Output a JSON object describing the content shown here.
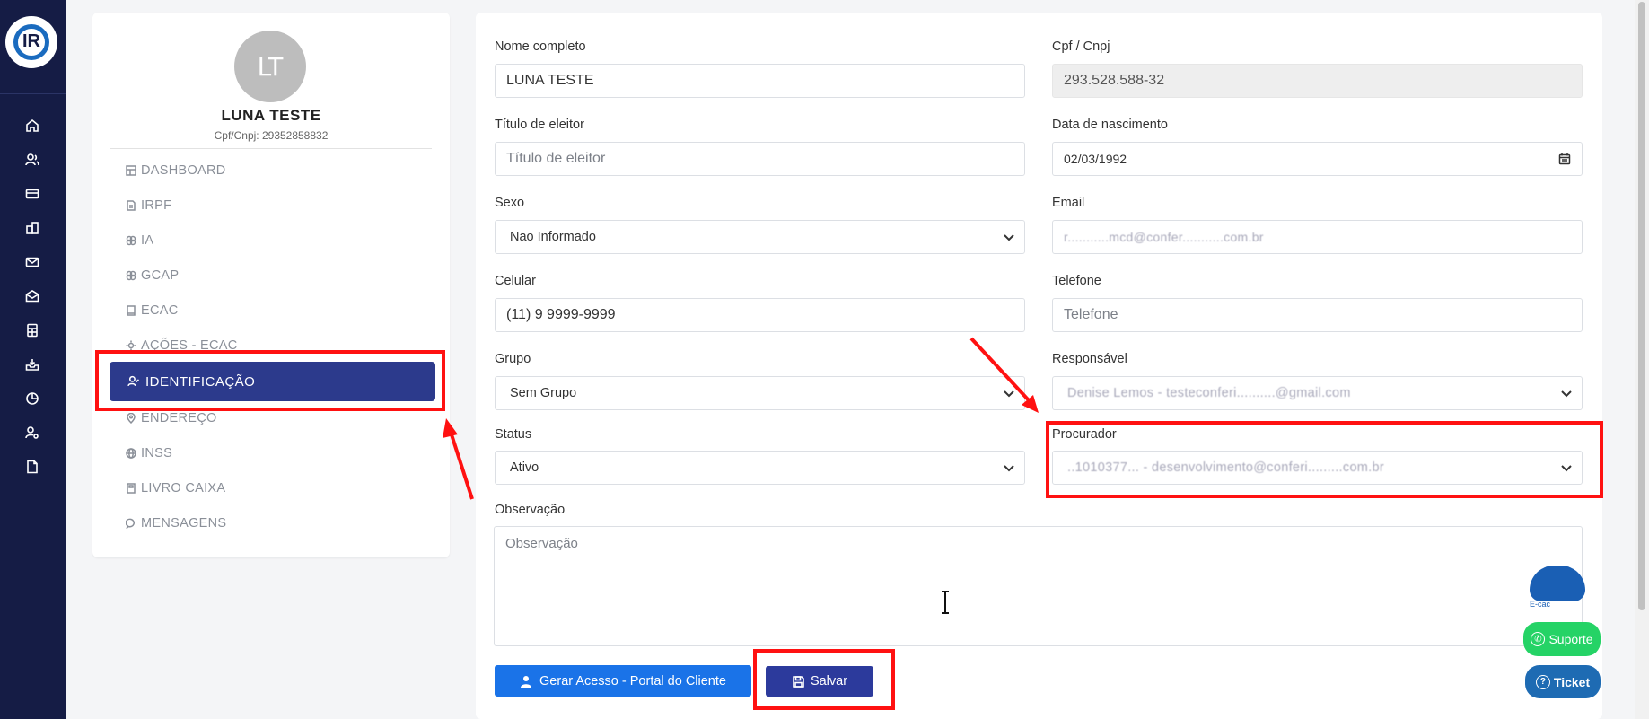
{
  "profile": {
    "initials": "LT",
    "name": "LUNA TESTE",
    "doc": "Cpf/Cnpj: 29352858832"
  },
  "menu": {
    "items": [
      {
        "label": "DASHBOARD"
      },
      {
        "label": "IRPF"
      },
      {
        "label": "IA"
      },
      {
        "label": "GCAP"
      },
      {
        "label": "ECAC"
      },
      {
        "label": "AÇÕES - ECAC"
      },
      {
        "label": "IDENTIFICAÇÃO"
      },
      {
        "label": "ENDEREÇO"
      },
      {
        "label": "INSS"
      },
      {
        "label": "LIVRO CAIXA"
      },
      {
        "label": "MENSAGENS"
      }
    ],
    "active": "IDENTIFICAÇÃO"
  },
  "rail": {
    "logo": "IR",
    "icons": [
      "home-icon",
      "users-icon",
      "card-icon",
      "building-icon",
      "mail-icon",
      "mail-open-icon",
      "spreadsheet-icon",
      "inbox-icon",
      "pie-chart-icon",
      "user-settings-icon",
      "document-icon"
    ]
  },
  "form": {
    "nome": {
      "label": "Nome completo",
      "value": "LUNA TESTE"
    },
    "cpf": {
      "label": "Cpf / Cnpj",
      "value": "293.528.588-32"
    },
    "titulo": {
      "label": "Título de eleitor",
      "placeholder": "Título de eleitor"
    },
    "nascimento": {
      "label": "Data de nascimento",
      "value": "02/03/1992"
    },
    "sexo": {
      "label": "Sexo",
      "value": "Nao Informado"
    },
    "email": {
      "label": "Email",
      "value": "r...........mcd@confer...........com.br"
    },
    "celular": {
      "label": "Celular",
      "value": "(11) 9 9999-9999"
    },
    "telefone": {
      "label": "Telefone",
      "placeholder": "Telefone"
    },
    "grupo": {
      "label": "Grupo",
      "value": "Sem Grupo"
    },
    "responsavel": {
      "label": "Responsável",
      "value": "Denise Lemos - testeconferi..........@gmail.com"
    },
    "status": {
      "label": "Status",
      "value": "Ativo"
    },
    "procurador": {
      "label": "Procurador",
      "value": "..1010377... - desenvolvimento@conferi.........com.br"
    },
    "observacao": {
      "label": "Observação",
      "placeholder": "Observação"
    }
  },
  "buttons": {
    "portal": "Gerar Acesso - Portal do Cliente",
    "salvar": "Salvar"
  },
  "widgets": {
    "ecac": "E-cac",
    "suporte": "Suporte",
    "ticket": "Ticket"
  },
  "colors": {
    "rail": "#151c45",
    "active_menu": "#2c3a8c",
    "primary_button": "#1a73e8",
    "save_button": "#2c3a9c",
    "highlight": "#ff1111",
    "whatsapp": "#25d366"
  }
}
